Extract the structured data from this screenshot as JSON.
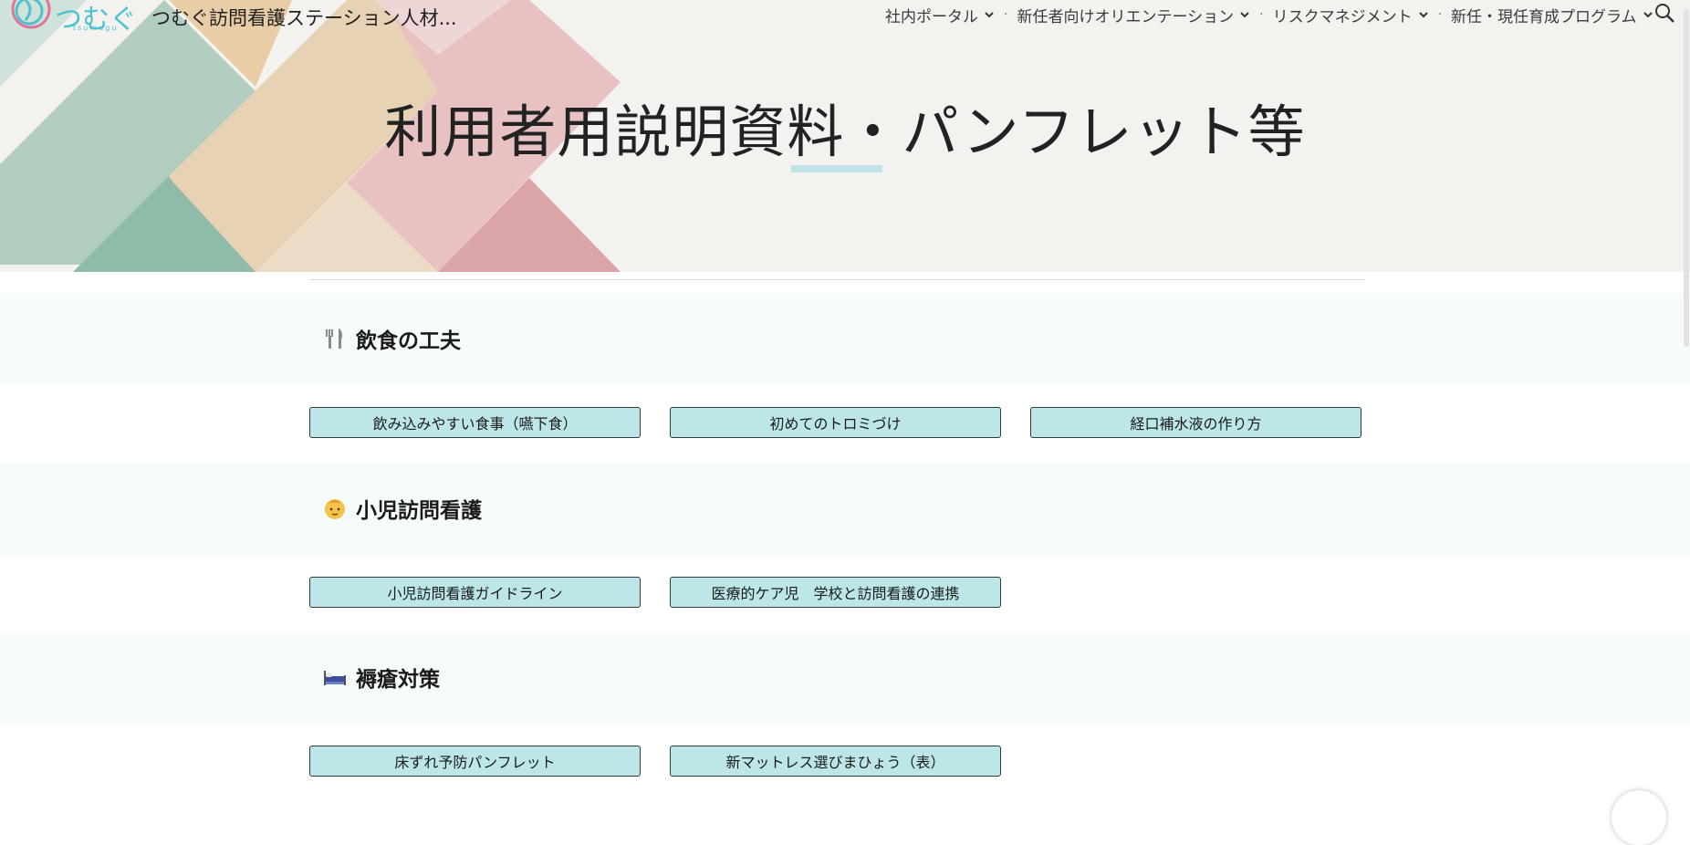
{
  "header": {
    "site_title": "つむぐ訪問看護ステーション人材...",
    "logo_text": "つむぐ",
    "logo_sub": "tsumugu",
    "nav": [
      {
        "label": "社内ポータル"
      },
      {
        "label": "新任者向けオリエンテーション"
      },
      {
        "label": "リスクマネジメント"
      },
      {
        "label": "新任・現任育成プログラム"
      }
    ],
    "nav_separator": "·",
    "search_icon": "search-icon"
  },
  "hero": {
    "title": "利用者用説明資料・パンフレット等",
    "colors": {
      "bg": "#f4f2ee",
      "mint": "#b0cdbf",
      "peach": "#e8d2b5",
      "pink": "#e8c1c3",
      "underline": "#bfe3e6"
    }
  },
  "sections": [
    {
      "heading": "飲食の工夫",
      "icon": "fork-knife-icon",
      "buttons": [
        "飲み込みやすい食事（嚥下食）",
        "初めてのトロミづけ",
        "経口補水液の作り方"
      ]
    },
    {
      "heading": "小児訪問看護",
      "icon": "baby-icon",
      "buttons": [
        "小児訪問看護ガイドライン",
        "医療的ケア児　学校と訪問看護の連携"
      ]
    },
    {
      "heading": "褥瘡対策",
      "icon": "bed-icon",
      "buttons": [
        "床ずれ予防パンフレット",
        "新マットレス選びまひょう（表）"
      ]
    }
  ],
  "theme": {
    "button_bg": "#bde6e8",
    "section_band": "#f6fcfc"
  }
}
